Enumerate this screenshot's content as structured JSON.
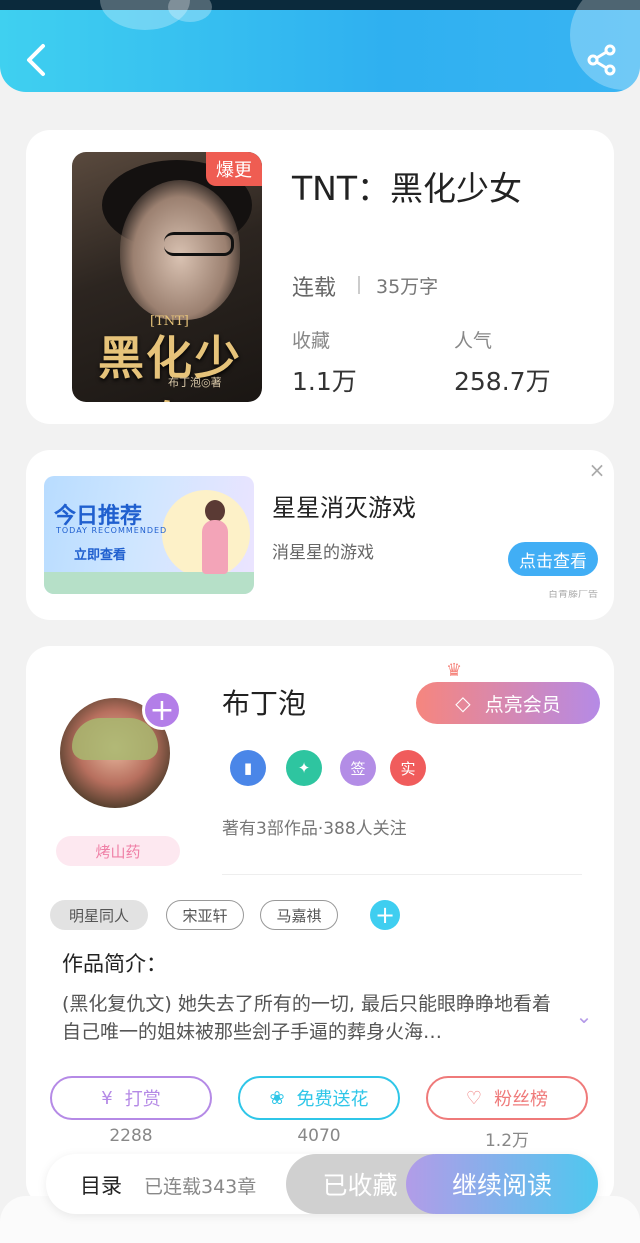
{
  "book": {
    "title": "TNT：黑化少女",
    "hot_badge": "爆更",
    "status": "连载",
    "words": "35万字",
    "cover_title": "黑化少女",
    "cover_tag": "[TNT]",
    "cover_author": "布丁泡◎著",
    "stats": [
      {
        "label": "收藏",
        "value": "1.1万"
      },
      {
        "label": "人气",
        "value": "258.7万"
      }
    ]
  },
  "ad": {
    "image_title": "今日推荐",
    "image_sub": "TODAY RECOMMENDED",
    "image_cta": "立即查看",
    "title": "星星消灭游戏",
    "subtitle": "消星星的游戏",
    "button": "点击查看",
    "close": "×",
    "source": "百青藤广告"
  },
  "author": {
    "name": "布丁泡",
    "vip_button": "点亮会员",
    "pink_tag": "烤山药",
    "medals": [
      {
        "text": "",
        "color": "#4a86e8"
      },
      {
        "text": "",
        "color": "#2ec5a0"
      },
      {
        "text": "签",
        "color": "#b38de6"
      },
      {
        "text": "实",
        "color": "#f05c5c"
      }
    ],
    "works": "著有3部作品·388人关注"
  },
  "tags": [
    "明星同人",
    "宋亚轩",
    "马嘉祺"
  ],
  "intro": {
    "heading": "作品简介：",
    "text": "(黑化复仇文) 她失去了所有的一切, 最后只能眼睁睁地看着自己唯一的姐妹被那些刽子手逼的葬身火海…"
  },
  "actions": [
    {
      "label": "打赏",
      "count": "2288",
      "color": "#b58ae6",
      "icon": "¥"
    },
    {
      "label": "免费送花",
      "count": "4070",
      "color": "#2fc6e8",
      "icon": "❀"
    },
    {
      "label": "粉丝榜",
      "count": "1.2万",
      "color": "#ef7a7a",
      "icon": "♡"
    }
  ],
  "bottom": {
    "catalog": "目录",
    "chapters": "已连载343章",
    "collected": "已收藏",
    "continue": "继续阅读"
  }
}
